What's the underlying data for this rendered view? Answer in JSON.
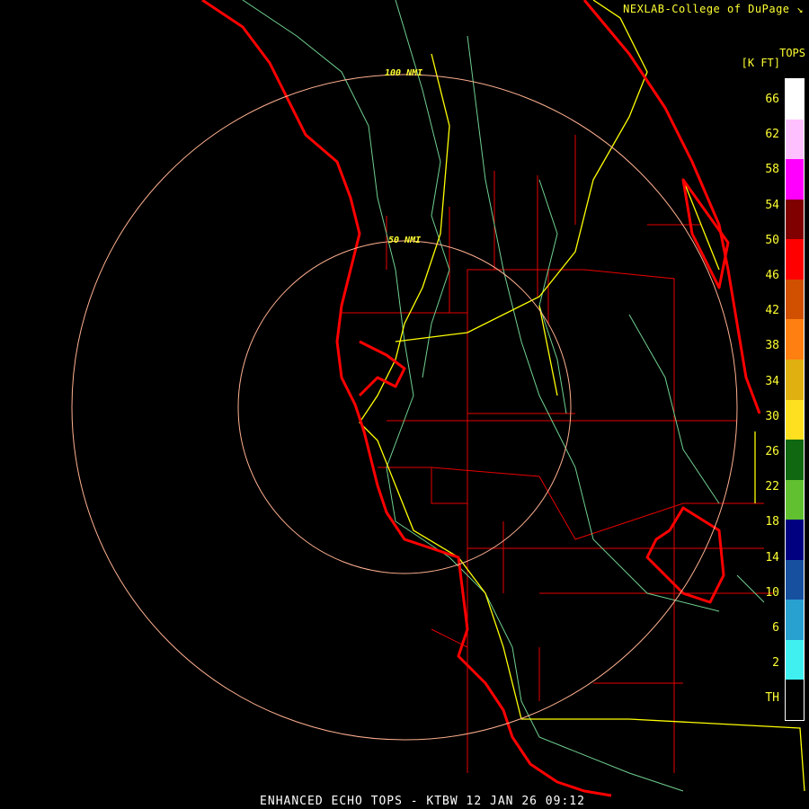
{
  "header": {
    "credit": "NEXLAB-College of DuPage",
    "credit_icon": "nexlab-logo-icon"
  },
  "legend": {
    "title": "TOPS",
    "units": "[K FT]",
    "labels": [
      "66",
      "62",
      "58",
      "54",
      "50",
      "46",
      "42",
      "38",
      "34",
      "30",
      "26",
      "22",
      "18",
      "14",
      "10",
      "6",
      "2",
      "TH"
    ],
    "colors": [
      "#ffffff",
      "#ffc0ff",
      "#ff00ff",
      "#800000",
      "#ff0000",
      "#d05000",
      "#ff8010",
      "#e0b010",
      "#ffe020",
      "#106810",
      "#60c030",
      "#000080",
      "#1850a0",
      "#28a0d0",
      "#40f0f0",
      "#000000"
    ]
  },
  "map": {
    "rings": [
      {
        "label": "50 NMI"
      },
      {
        "label": "100 NMI"
      }
    ],
    "colors": {
      "coast": "#ff0000",
      "county": "#ff0000",
      "roads": "#ffff00",
      "rivers": "#70d090",
      "rings": "#ffb090"
    }
  },
  "footer": {
    "title": "ENHANCED ECHO TOPS - KTBW 12 JAN 26 09:12"
  }
}
